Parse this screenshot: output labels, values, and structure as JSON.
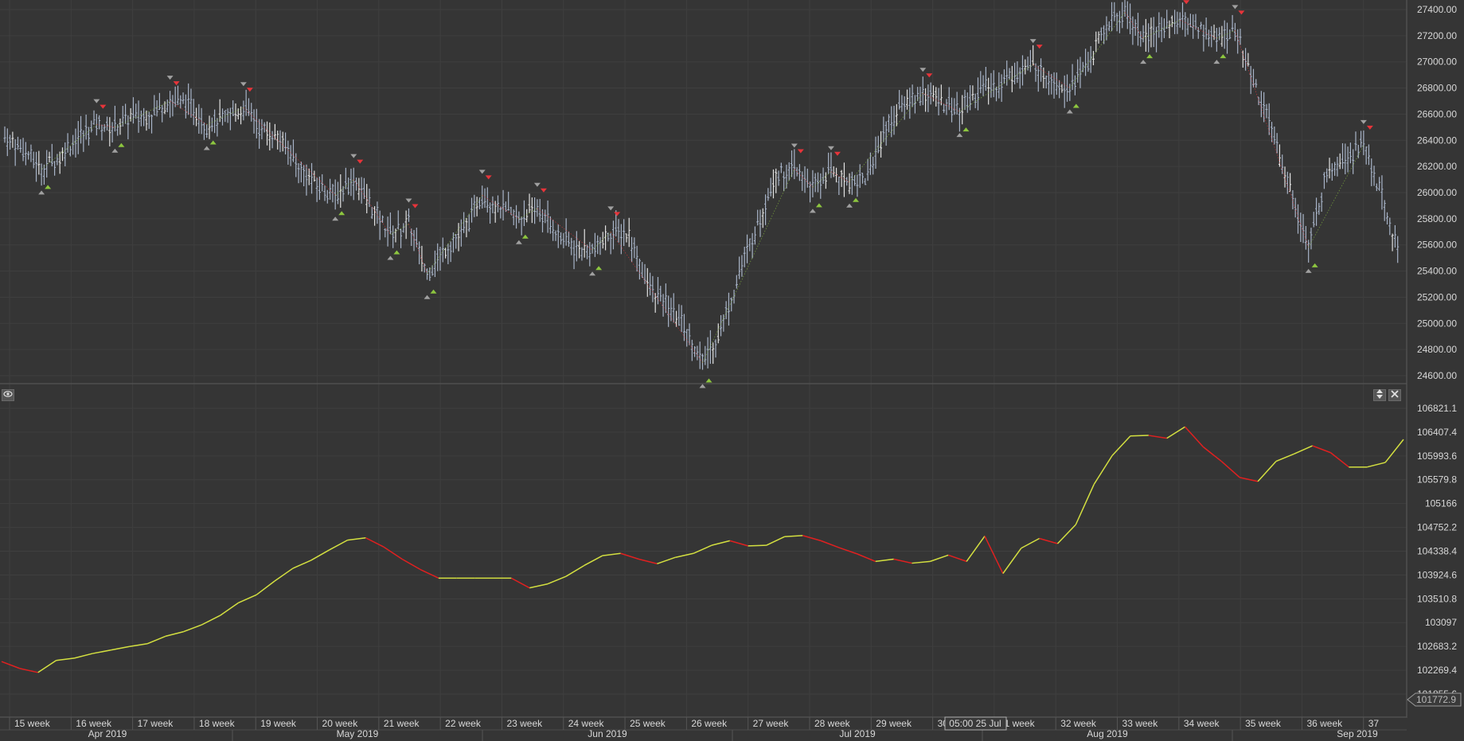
{
  "colors": {
    "background": "#353535",
    "grid": "#3f3f3f",
    "bar": "#a8b4c8",
    "bar_alt": "#e2e2e2",
    "up_marker": "#8dc63f",
    "down_marker": "#e8343a",
    "swing_marker": "#a0a0a0",
    "equity_up": "#d4e040",
    "equity_down": "#e02020",
    "axis_text": "#d8d8d8",
    "last_price_tag": "#3a3a3a"
  },
  "icons": {
    "visibility": "eye-icon",
    "resize": "updown-arrows-icon",
    "close": "close-icon"
  },
  "crosshair_label": "05:00 25 Jul",
  "equity_last_value": "101772.9",
  "chart_data": [
    {
      "type": "ohlc",
      "y_ticks": [
        "27400.00",
        "27200.00",
        "27000.00",
        "26800.00",
        "26600.00",
        "26400.00",
        "26200.00",
        "26000.00",
        "25800.00",
        "25600.00",
        "25400.00",
        "25200.00",
        "25000.00",
        "24800.00",
        "24600.00"
      ],
      "ylim": [
        24560,
        27450
      ],
      "x": [
        0,
        3,
        6,
        9,
        12,
        15,
        18,
        21,
        24,
        27,
        30,
        33,
        36,
        39,
        42,
        45,
        48,
        51,
        54,
        57,
        60,
        63,
        66,
        69,
        72,
        75,
        78,
        81,
        84,
        87,
        90,
        93,
        96,
        99,
        102,
        105,
        108,
        111,
        114,
        117,
        120,
        123,
        126,
        129,
        132,
        135,
        138,
        141,
        144,
        147,
        150,
        153,
        156,
        159,
        162,
        165,
        168,
        171,
        174,
        177,
        180,
        183,
        186,
        189,
        192,
        195,
        198,
        201,
        204,
        207,
        210,
        213,
        216,
        219,
        222,
        225,
        228
      ],
      "close": [
        26420,
        26330,
        26180,
        26280,
        26420,
        26520,
        26500,
        26580,
        26600,
        26700,
        26680,
        26520,
        26560,
        26650,
        26480,
        26420,
        26200,
        26060,
        25980,
        26100,
        25880,
        25680,
        25760,
        25380,
        25580,
        25700,
        25980,
        25880,
        25800,
        25880,
        25700,
        25580,
        25560,
        25700,
        25680,
        25300,
        25150,
        24980,
        24700,
        24960,
        25380,
        25760,
        26150,
        26180,
        26040,
        26160,
        26080,
        26120,
        26500,
        26680,
        26760,
        26700,
        26620,
        26780,
        26820,
        26900,
        26980,
        26870,
        26800,
        26990,
        27280,
        27380,
        27180,
        27260,
        27320,
        27260,
        27180,
        27240,
        26850,
        26480,
        26020,
        25580,
        26160,
        26280,
        26360,
        25960,
        25480
      ]
    },
    {
      "type": "line",
      "series": [
        {
          "name": "",
          "values": [
            102420,
            102300,
            102230,
            102440,
            102480,
            102560,
            102620,
            102680,
            102730,
            102860,
            102940,
            103060,
            103220,
            103440,
            103580,
            103820,
            104040,
            104180,
            104360,
            104530,
            104570,
            104410,
            104200,
            104020,
            103870,
            103870,
            103870,
            103870,
            103870,
            103700,
            103770,
            103900,
            104090,
            104260,
            104300,
            104200,
            104120,
            104230,
            104300,
            104440,
            104520,
            104430,
            104440,
            104590,
            104610,
            104520,
            104400,
            104290,
            104160,
            104200,
            104130,
            104160,
            104270,
            104160,
            104600,
            103950,
            104390,
            104560,
            104470,
            104800,
            105500,
            106000,
            106340,
            106350,
            106300,
            106500,
            106150,
            105900,
            105620,
            105550,
            105900,
            106030,
            106170,
            106050,
            105800,
            105800,
            105880,
            106280
          ]
        }
      ],
      "y_ticks": [
        "106821.1",
        "106407.4",
        "105993.6",
        "105579.8",
        "105166",
        "104752.2",
        "104338.4",
        "103924.6",
        "103510.8",
        "103097",
        "102683.2",
        "102269.4",
        "101855.6"
      ],
      "ylim": [
        101772,
        106850
      ]
    }
  ],
  "x_axis": {
    "weeks": [
      "15 week",
      "16 week",
      "17 week",
      "18 week",
      "19 week",
      "20 week",
      "21 week",
      "22 week",
      "23 week",
      "24 week",
      "25 week",
      "26 week",
      "27 week",
      "28 week",
      "29 week",
      "30 week",
      "31 week",
      "32 week",
      "33 week",
      "34 week",
      "35 week",
      "36 week",
      "37"
    ],
    "months": [
      "Apr 2019",
      "May 2019",
      "Jun 2019",
      "Jul 2019",
      "Aug 2019",
      "Sep 2019"
    ]
  }
}
